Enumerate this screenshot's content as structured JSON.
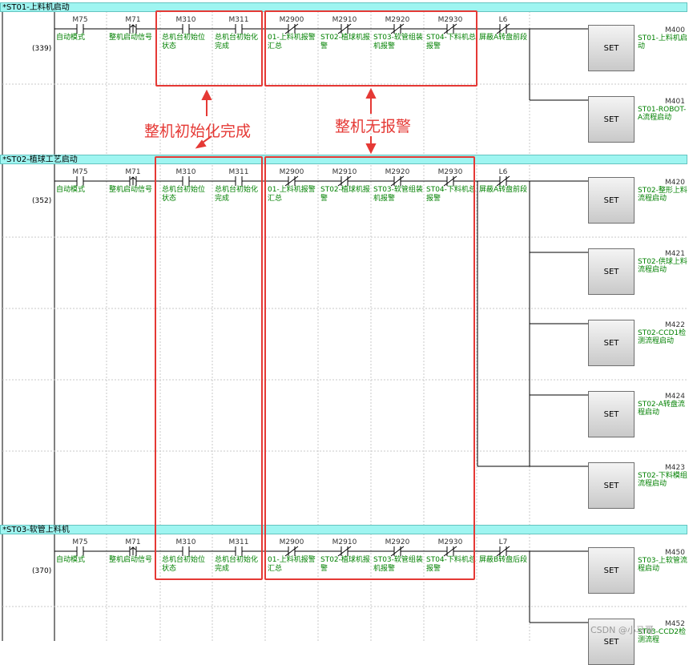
{
  "rungs": [
    {
      "header": "*ST01-上料机启动",
      "step": "(339)",
      "contacts": [
        {
          "dev": "M75",
          "comment": "自动模式",
          "type": "no"
        },
        {
          "dev": "M71",
          "comment": "整机启动信号",
          "type": "pulse"
        },
        {
          "dev": "M310",
          "comment": "总机台初始位状态",
          "type": "no"
        },
        {
          "dev": "M311",
          "comment": "总机台初始化完成",
          "type": "no"
        },
        {
          "dev": "M2900",
          "comment": "01-上料机报警汇总",
          "type": "nc"
        },
        {
          "dev": "M2910",
          "comment": "ST02-植球机报警",
          "type": "nc"
        },
        {
          "dev": "M2920",
          "comment": "ST03-软管组装机报警",
          "type": "nc"
        },
        {
          "dev": "M2930",
          "comment": "ST04-下料机总报警",
          "type": "nc"
        },
        {
          "dev": "L6",
          "comment": "屏蔽A转盘前段",
          "type": "nc"
        }
      ],
      "coils": [
        {
          "dev": "M400",
          "comment": "ST01-上料机启动",
          "instr": "SET"
        },
        {
          "dev": "M401",
          "comment": "ST01-ROBOT-A流程启动",
          "instr": "SET"
        }
      ]
    },
    {
      "header": "*ST02-植球工艺启动",
      "step": "(352)",
      "contacts": [
        {
          "dev": "M75",
          "comment": "自动模式",
          "type": "no"
        },
        {
          "dev": "M71",
          "comment": "整机启动信号",
          "type": "pulse"
        },
        {
          "dev": "M310",
          "comment": "总机台初始位状态",
          "type": "no"
        },
        {
          "dev": "M311",
          "comment": "总机台初始化完成",
          "type": "no"
        },
        {
          "dev": "M2900",
          "comment": "01-上料机报警汇总",
          "type": "nc"
        },
        {
          "dev": "M2910",
          "comment": "ST02-植球机报警",
          "type": "nc"
        },
        {
          "dev": "M2920",
          "comment": "ST03-软管组装机报警",
          "type": "nc"
        },
        {
          "dev": "M2930",
          "comment": "ST04-下料机总报警",
          "type": "nc"
        },
        {
          "dev": "L6",
          "comment": "屏蔽A转盘前段",
          "type": "nc"
        }
      ],
      "coils": [
        {
          "dev": "M420",
          "comment": "ST02-整形上料流程启动",
          "instr": "SET"
        },
        {
          "dev": "M421",
          "comment": "ST02-供球上料流程启动",
          "instr": "SET"
        },
        {
          "dev": "M422",
          "comment": "ST02-CCD1检测流程启动",
          "instr": "SET"
        },
        {
          "dev": "M424",
          "comment": "ST02-A转盘流程启动",
          "instr": "SET"
        },
        {
          "dev": "M423",
          "comment": "ST02-下料模组流程启动",
          "instr": "SET"
        }
      ]
    },
    {
      "header": "*ST03-软管上料机",
      "step": "(370)",
      "contacts": [
        {
          "dev": "M75",
          "comment": "自动模式",
          "type": "no"
        },
        {
          "dev": "M71",
          "comment": "整机启动信号",
          "type": "pulse"
        },
        {
          "dev": "M310",
          "comment": "总机台初始位状态",
          "type": "no"
        },
        {
          "dev": "M311",
          "comment": "总机台初始化完成",
          "type": "no"
        },
        {
          "dev": "M2900",
          "comment": "01-上料机报警汇总",
          "type": "nc"
        },
        {
          "dev": "M2910",
          "comment": "ST02-植球机报警",
          "type": "nc"
        },
        {
          "dev": "M2920",
          "comment": "ST03-软管组装机报警",
          "type": "nc"
        },
        {
          "dev": "M2930",
          "comment": "ST04-下料机总报警",
          "type": "nc"
        },
        {
          "dev": "L7",
          "comment": "屏蔽B转盘后段",
          "type": "nc"
        }
      ],
      "coils": [
        {
          "dev": "M450",
          "comment": "ST03-上软管流程启动",
          "instr": "SET"
        },
        {
          "dev": "M452",
          "comment": "ST03-CCD2检测流程",
          "instr": "SET"
        }
      ]
    }
  ],
  "annotations": {
    "init_label": "整机初始化完成",
    "alarm_label": "整机无报警"
  },
  "watermark": "CSDN @小马哥",
  "colors": {
    "header_bg": "#9ff5f1",
    "comment": "#008000",
    "annotation": "#e53935"
  }
}
